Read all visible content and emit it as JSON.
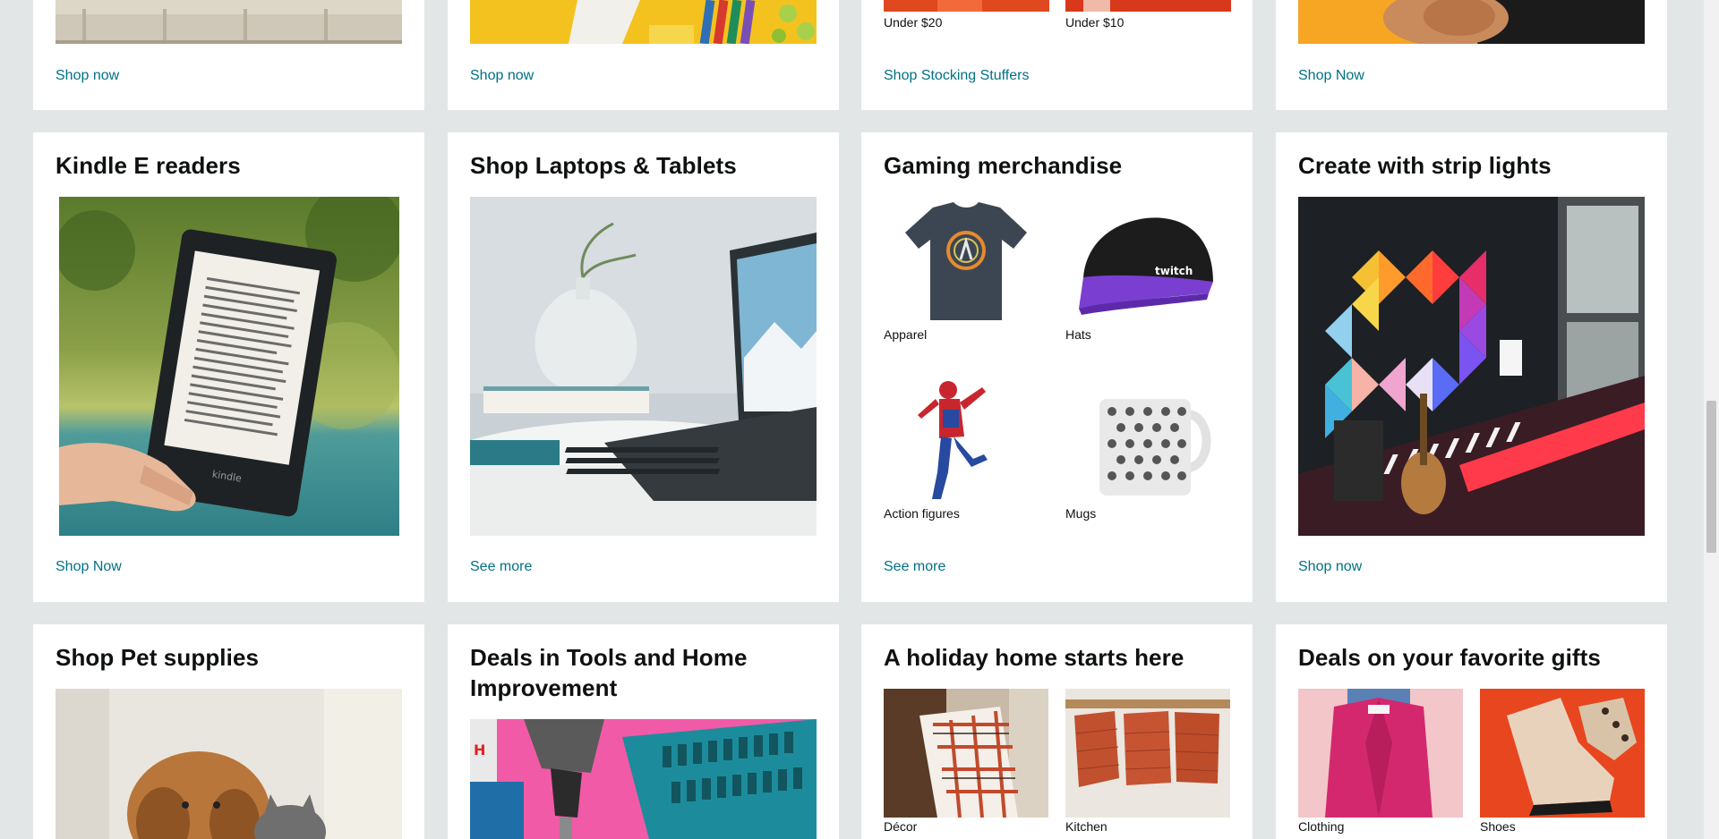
{
  "colors": {
    "background": "#e3e6e6",
    "card": "#ffffff",
    "link": "#007185",
    "text": "#0f1111"
  },
  "row1": {
    "card1": {
      "link": "Shop now"
    },
    "card2": {
      "link": "Shop now"
    },
    "card3": {
      "labels": [
        "Under $20",
        "Under $10"
      ],
      "link": "Shop Stocking Stuffers"
    },
    "card4": {
      "link": "Shop Now"
    }
  },
  "row2": {
    "kindle": {
      "title": "Kindle E readers",
      "link": "Shop Now",
      "device_brand": "kindle"
    },
    "laptops": {
      "title": "Shop Laptops & Tablets",
      "link": "See more"
    },
    "gaming": {
      "title": "Gaming merchandise",
      "items": [
        {
          "label": "Apparel",
          "icon": "tshirt-icon"
        },
        {
          "label": "Hats",
          "icon": "cap-icon",
          "cap_text": "twitch"
        },
        {
          "label": "Action figures",
          "icon": "figure-icon"
        },
        {
          "label": "Mugs",
          "icon": "mug-icon"
        }
      ],
      "link": "See more"
    },
    "strip": {
      "title": "Create with strip lights",
      "link": "Shop now"
    }
  },
  "row3": {
    "pets": {
      "title": "Shop Pet supplies"
    },
    "tools": {
      "title": "Deals in Tools and Home Improvement"
    },
    "holiday": {
      "title": "A holiday home starts here",
      "items": [
        "Décor",
        "Kitchen"
      ]
    },
    "gifts": {
      "title": "Deals on your favorite gifts",
      "items": [
        "Clothing",
        "Shoes"
      ]
    }
  }
}
